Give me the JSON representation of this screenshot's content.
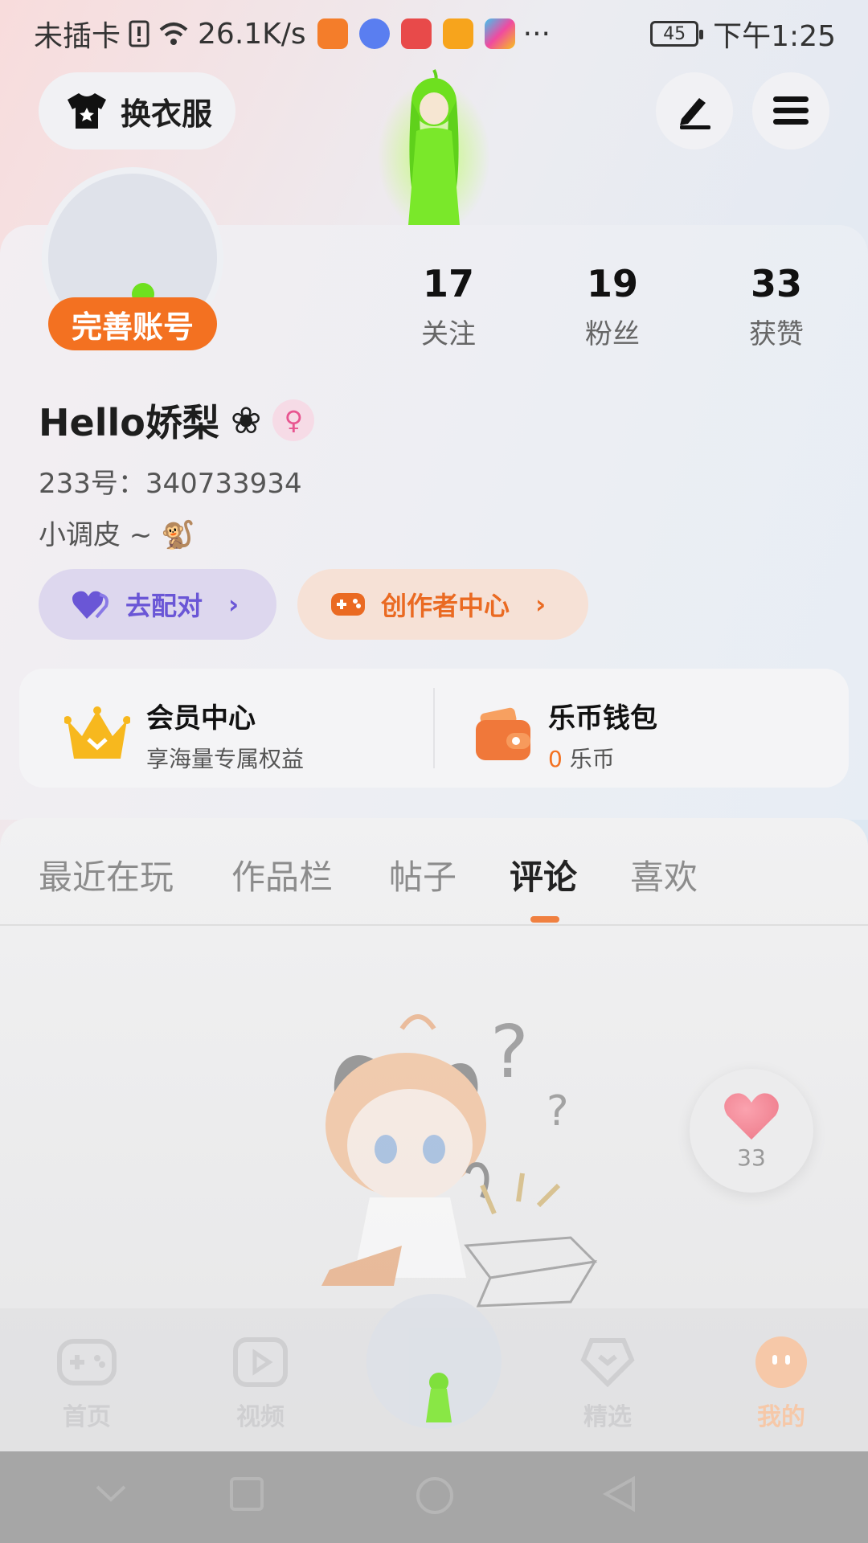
{
  "status_bar": {
    "carrier": "未插卡",
    "speed": "26.1K/s",
    "more": "···",
    "battery": "45",
    "time": "下午1:25"
  },
  "header": {
    "outfit_label": "换衣服",
    "edit_icon": "pen-icon",
    "menu_icon": "hamburger-menu-icon"
  },
  "profile": {
    "complete_badge": "完善账号",
    "stats": [
      {
        "value": "17",
        "label": "关注"
      },
      {
        "value": "19",
        "label": "粉丝"
      },
      {
        "value": "33",
        "label": "获赞"
      }
    ],
    "name": "Hello娇梨",
    "name_symbol": "❀",
    "gender_symbol": "♀",
    "uid": "233号：340733934",
    "bio": "小调皮 ~ 🐒",
    "match_label": "去配对",
    "creator_label": "创作者中心"
  },
  "cards": {
    "vip_title": "会员中心",
    "vip_sub": "享海量专属权益",
    "wallet_title": "乐币钱包",
    "wallet_amount": "0",
    "wallet_unit": "乐币"
  },
  "tabs": [
    {
      "label": "最近在玩",
      "active": false
    },
    {
      "label": "作品栏",
      "active": false
    },
    {
      "label": "帖子",
      "active": false
    },
    {
      "label": "评论",
      "active": true
    },
    {
      "label": "喜欢",
      "active": false
    }
  ],
  "like_fab": {
    "count": "33"
  },
  "bottom_nav": [
    {
      "label": "首页",
      "icon": "gamepad-icon"
    },
    {
      "label": "视频",
      "icon": "video-play-icon"
    },
    {
      "label": "精选",
      "icon": "heart-badge-icon"
    },
    {
      "label": "我的",
      "icon": "face-icon",
      "active": true
    }
  ],
  "colors": {
    "accent_orange": "#f37121",
    "match_purple": "#6a56d6",
    "creator_orange": "#ea6a22"
  }
}
